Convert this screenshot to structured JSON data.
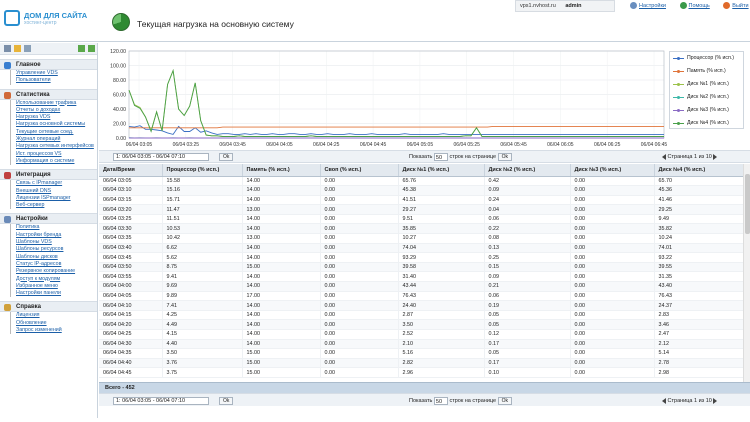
{
  "header": {
    "logo_line1": "ДОМ ДЛЯ САЙТА",
    "logo_line2": "хостинг-центр",
    "page_title": "Текущая нагрузка на основную систему",
    "host": "vps1.nvhost.ru",
    "user": "admin",
    "links": [
      "Настройки",
      "Помощь",
      "Выйти"
    ]
  },
  "sidebar": {
    "sections": [
      {
        "title": "Главное",
        "items": [
          "Управление VDS",
          "Пользователи"
        ]
      },
      {
        "title": "Статистика",
        "items": [
          "Использование трафика",
          "Отчеты о доходах",
          "Нагрузка VDS",
          "Нагрузка основной системы",
          "Текущие сетевые соед.",
          "Журнал операций",
          "Нагрузка сетевых интерфейсов",
          "Ист. процессов VS",
          "Информация о системе"
        ]
      },
      {
        "title": "Интеграция",
        "items": [
          "Связь с IPmanager",
          "Внешний DNS",
          "Лицензии ISPmanager",
          "Веб-сервер"
        ]
      },
      {
        "title": "Настройки",
        "items": [
          "Политика",
          "Настройки бренда",
          "Шаблоны VDS",
          "Шаблоны ресурсов",
          "Шаблоны дисков",
          "Статус IP-адресов",
          "Резервное копирование",
          "Доступ к модулям",
          "Избранное меню",
          "Настройки панели"
        ]
      },
      {
        "title": "Справка",
        "items": [
          "Лицензия",
          "Обновление",
          "Запрос изменений"
        ]
      }
    ]
  },
  "chart_data": {
    "type": "line",
    "ylim": [
      0,
      120
    ],
    "yticks": [
      "120.00",
      "100.00",
      "80.00",
      "60.00",
      "40.00",
      "20.00",
      "0.00"
    ],
    "x": [
      "06/04 03:05",
      "06/04 03:25",
      "06/04 03:45",
      "06/04 04:05",
      "06/04 04:25",
      "06/04 04:45",
      "06/04 05:05",
      "06/04 05:25",
      "06/04 05:45",
      "06/04 06:05",
      "06/04 06:25",
      "06/04 06:45"
    ],
    "series": [
      {
        "name": "Процессор (% исп.)",
        "color": "#3a6fc4",
        "values": [
          16,
          15,
          17,
          12,
          12,
          11,
          10,
          7,
          5,
          16,
          9,
          9,
          14,
          8,
          10,
          7,
          5,
          6,
          6,
          5,
          5,
          6,
          5,
          6,
          5,
          5,
          6,
          5,
          5,
          6,
          6,
          5,
          5,
          6,
          5,
          5,
          6,
          5,
          5,
          5,
          6,
          5,
          5,
          5,
          6,
          5,
          5,
          5,
          5,
          5,
          6,
          5,
          5,
          5,
          5,
          5,
          5,
          6,
          5,
          5,
          5,
          5,
          5,
          5,
          5,
          5,
          5,
          5,
          5,
          5,
          5,
          5,
          5,
          5,
          5,
          5,
          5,
          5,
          5,
          5,
          5,
          5,
          5,
          5,
          5,
          5,
          5,
          5,
          5,
          5,
          5,
          5,
          5,
          5,
          5,
          5,
          5,
          5
        ]
      },
      {
        "name": "Память (% исп.)",
        "color": "#e0743a",
        "values": [
          14,
          14,
          14,
          14,
          14,
          14,
          14,
          14,
          14,
          14,
          14,
          14,
          14,
          14,
          14,
          14,
          14,
          15,
          15,
          15,
          15,
          15,
          15,
          15,
          15,
          15,
          15,
          15,
          15,
          15,
          15,
          15,
          15,
          15,
          15,
          15,
          15,
          15,
          15,
          15,
          15,
          15,
          15,
          15,
          15,
          15,
          15,
          15,
          15,
          15,
          15,
          15,
          15,
          15,
          15,
          15,
          15,
          15,
          15,
          15,
          15,
          15,
          15,
          15,
          15,
          15,
          16,
          16,
          16,
          16,
          16,
          16,
          16,
          16,
          16,
          16,
          16,
          16,
          16,
          16,
          16,
          16,
          16,
          16,
          16,
          16,
          16,
          16,
          16,
          16,
          16,
          16,
          16,
          16,
          16,
          16,
          16,
          16
        ]
      },
      {
        "name": "Диск №1 (% исп.)",
        "color": "#9bc24a",
        "values": [
          66,
          46,
          42,
          29,
          10,
          36,
          10,
          74,
          93,
          40,
          31,
          44,
          76,
          24,
          4,
          3,
          3,
          2,
          2,
          2,
          3,
          2,
          2,
          2,
          2,
          2,
          2,
          2,
          2,
          2,
          2,
          2,
          2,
          3,
          2,
          2,
          2,
          2,
          2,
          2,
          2,
          2,
          2,
          2,
          2,
          2,
          2,
          2,
          2,
          2,
          2,
          2,
          2,
          2,
          2,
          2,
          2,
          2,
          2,
          2,
          2,
          3,
          3,
          14,
          2,
          2,
          2,
          2,
          2,
          2,
          2,
          2,
          2,
          2,
          2,
          2,
          2,
          2,
          2,
          2,
          2,
          2,
          2,
          2,
          2,
          2,
          2,
          2,
          2,
          2,
          2,
          2,
          2,
          2,
          2,
          2,
          2,
          2
        ]
      },
      {
        "name": "Диск №2 (% исп.)",
        "color": "#3cb8a8",
        "values": [
          0.42,
          0.09,
          0.24,
          0.04,
          0.06,
          0.22,
          0.08,
          0.13,
          0.25,
          0.15,
          0.09,
          0.21,
          0.06,
          0.19,
          0.05,
          0.05,
          0.12,
          0.17,
          0.17,
          0.1,
          0.1,
          0.1,
          0.1,
          0.1,
          0.1,
          0.1,
          0.1,
          0.1,
          0.1,
          0.1,
          0.1,
          0.1,
          0.1,
          0.1,
          0.1,
          0.1,
          0.1,
          0.1,
          0.1,
          0.1,
          0.1,
          0.1,
          0.1,
          0.1,
          0.1,
          0.1,
          0.1,
          0.1,
          0.1,
          0.1,
          0.1,
          0.1,
          0.1,
          0.1,
          0.1,
          0.1,
          0.1,
          0.1,
          0.1,
          0.1,
          0.1,
          0.1,
          0.1,
          0.1,
          0.1,
          0.1,
          0.1,
          0.1,
          0.1,
          0.1,
          0.1,
          0.1,
          0.1,
          0.1,
          0.1,
          0.1,
          0.1,
          0.1,
          0.1,
          0.1,
          0.1,
          0.1,
          0.1,
          0.1,
          0.1,
          0.1,
          0.1,
          0.1,
          0.1,
          0.1,
          0.1,
          0.1,
          0.1,
          0.1,
          0.1,
          0.1,
          0.1,
          0.1
        ]
      },
      {
        "name": "Диск №3 (% исп.)",
        "color": "#8a6ac4",
        "values": [
          0,
          0,
          0,
          0,
          0,
          0,
          0,
          0,
          0,
          0,
          0,
          0,
          0,
          0,
          0,
          0,
          0,
          0,
          0,
          0,
          0,
          0,
          0,
          0,
          0,
          0,
          0,
          0,
          0,
          0,
          0,
          0,
          0,
          0,
          0,
          0,
          0,
          0,
          0,
          0,
          0,
          0,
          0,
          0,
          0,
          0,
          0,
          0,
          0,
          0,
          0,
          0,
          0,
          0,
          0,
          0,
          0,
          0,
          0,
          0,
          0,
          0,
          0,
          0,
          0,
          0,
          0,
          0,
          0,
          0,
          0,
          0,
          0,
          0,
          0,
          0,
          0,
          0,
          0,
          0,
          0,
          0,
          0,
          0,
          0,
          0,
          0,
          0,
          0,
          0,
          0,
          0,
          0,
          0,
          0,
          0,
          0,
          0
        ]
      },
      {
        "name": "Диск №4 (% исп.)",
        "color": "#4aa04a",
        "values": [
          66,
          45,
          41,
          29,
          9,
          36,
          10,
          74,
          93,
          40,
          31,
          44,
          76,
          24,
          4,
          3,
          3,
          2,
          2,
          2,
          3,
          2,
          2,
          2,
          2,
          2,
          2,
          2,
          2,
          2,
          2,
          2,
          2,
          3,
          2,
          2,
          2,
          2,
          2,
          2,
          2,
          2,
          2,
          2,
          2,
          2,
          2,
          2,
          2,
          2,
          2,
          2,
          2,
          2,
          2,
          2,
          2,
          2,
          2,
          2,
          2,
          3,
          3,
          14,
          2,
          2,
          2,
          2,
          2,
          2,
          2,
          2,
          2,
          2,
          2,
          2,
          2,
          2,
          2,
          2,
          2,
          2,
          2,
          2,
          2,
          2,
          2,
          2,
          2,
          2,
          2,
          2,
          2,
          2,
          2,
          2,
          2,
          2
        ]
      }
    ]
  },
  "filter": {
    "range": "1: 06/04 03:05 - 06/04 07:10",
    "ok": "Ok",
    "shown_label": "Показать",
    "per_page": "50",
    "per_page_suffix": "строк на странице",
    "page_text": "Страница 1 из 10"
  },
  "table": {
    "columns": [
      "Дата/Время",
      "Процессор (% исп.)",
      "Память (% исп.)",
      "Своп (% исп.)",
      "Диск №1 (% исп.)",
      "Диск №2 (% исп.)",
      "Диск №3 (% исп.)",
      "Диск №4 (% исп.)"
    ],
    "rows": [
      [
        "06/04 03:05",
        "15.58",
        "14.00",
        "0.00",
        "65.76",
        "0.42",
        "0.00",
        "65.70"
      ],
      [
        "06/04 03:10",
        "15.16",
        "14.00",
        "0.00",
        "45.38",
        "0.09",
        "0.00",
        "45.36"
      ],
      [
        "06/04 03:15",
        "15.71",
        "14.00",
        "0.00",
        "41.51",
        "0.24",
        "0.00",
        "41.46"
      ],
      [
        "06/04 03:20",
        "11.47",
        "13.00",
        "0.00",
        "29.27",
        "0.04",
        "0.00",
        "29.25"
      ],
      [
        "06/04 03:25",
        "11.51",
        "14.00",
        "0.00",
        "9.51",
        "0.06",
        "0.00",
        "9.49"
      ],
      [
        "06/04 03:30",
        "10.53",
        "14.00",
        "0.00",
        "35.85",
        "0.22",
        "0.00",
        "35.82"
      ],
      [
        "06/04 03:35",
        "10.42",
        "13.00",
        "0.00",
        "10.27",
        "0.08",
        "0.00",
        "10.24"
      ],
      [
        "06/04 03:40",
        "6.62",
        "14.00",
        "0.00",
        "74.04",
        "0.13",
        "0.00",
        "74.01"
      ],
      [
        "06/04 03:45",
        "5.62",
        "14.00",
        "0.00",
        "93.29",
        "0.25",
        "0.00",
        "93.22"
      ],
      [
        "06/04 03:50",
        "8.75",
        "15.00",
        "0.00",
        "39.58",
        "0.15",
        "0.00",
        "39.55"
      ],
      [
        "06/04 03:55",
        "9.41",
        "14.00",
        "0.00",
        "31.40",
        "0.09",
        "0.00",
        "31.35"
      ],
      [
        "06/04 04:00",
        "9.69",
        "14.00",
        "0.00",
        "43.44",
        "0.21",
        "0.00",
        "43.40"
      ],
      [
        "06/04 04:05",
        "9.89",
        "17.00",
        "0.00",
        "76.43",
        "0.06",
        "0.00",
        "76.43"
      ],
      [
        "06/04 04:10",
        "7.41",
        "14.00",
        "0.00",
        "24.40",
        "0.19",
        "0.00",
        "24.37"
      ],
      [
        "06/04 04:15",
        "4.25",
        "14.00",
        "0.00",
        "2.87",
        "0.05",
        "0.00",
        "2.83"
      ],
      [
        "06/04 04:20",
        "4.49",
        "14.00",
        "0.00",
        "3.50",
        "0.05",
        "0.00",
        "3.46"
      ],
      [
        "06/04 04:25",
        "4.15",
        "14.00",
        "0.00",
        "2.52",
        "0.12",
        "0.00",
        "2.47"
      ],
      [
        "06/04 04:30",
        "4.40",
        "14.00",
        "0.00",
        "2.10",
        "0.17",
        "0.00",
        "2.12"
      ],
      [
        "06/04 04:35",
        "3.50",
        "15.00",
        "0.00",
        "5.16",
        "0.05",
        "0.00",
        "5.14"
      ],
      [
        "06/04 04:40",
        "3.76",
        "15.00",
        "0.00",
        "2.82",
        "0.17",
        "0.00",
        "2.78"
      ],
      [
        "06/04 04:45",
        "3.75",
        "15.00",
        "0.00",
        "2.96",
        "0.10",
        "0.00",
        "2.98"
      ]
    ],
    "total": "Всего - 452"
  }
}
